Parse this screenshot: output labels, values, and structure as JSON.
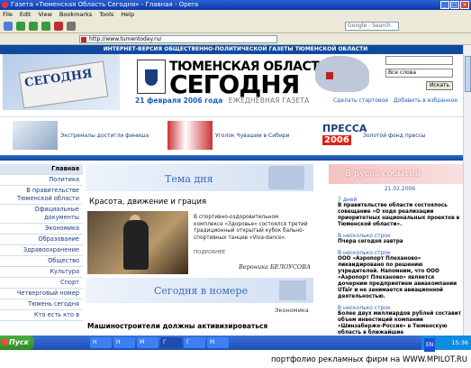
{
  "window": {
    "title": "Газета «Тюменская Область Сегодня» - Главная - Opera"
  },
  "menu": [
    "File",
    "Edit",
    "View",
    "Bookmarks",
    "Tools",
    "Help"
  ],
  "toolbar": {
    "search_placeholder": "Google - Search"
  },
  "address": {
    "url": "http://www.tumentoday.ru/"
  },
  "site": {
    "banner": "ИНТЕРНЕТ-ВЕРСИЯ ОБЩЕСТВЕННО-ПОЛИТИЧЕСКОЙ ГАЗЕТЫ ТЮМЕНСКОЙ ОБЛАСТИ",
    "logo_small": "СЕГОДНЯ",
    "logo_top": "ТЮМЕНСКАЯ ОБЛАСТЬ",
    "logo_main": "СЕГОДНЯ",
    "date": "21 февраля 2006 года",
    "subtitle": "ЕЖЕДНЕВНАЯ ГАЗЕТА",
    "search_select": "Все слова",
    "search_button": "Искать",
    "link_start": "Сделать стартовой",
    "link_fav": "Добавить в избранное"
  },
  "promos": [
    {
      "label": "Экстремалы достигли финиша"
    },
    {
      "label": "Уголок Чувашии в Сибири"
    },
    {
      "label": "Золотой фонд прессы",
      "press": "ПРЕССА",
      "year": "2006"
    }
  ],
  "nav": [
    "Главная",
    "Политика",
    "В правительстве Тюменской области",
    "Официальные документы",
    "Экономика",
    "Образование",
    "Здравоохранение",
    "Общество",
    "Культура",
    "Спорт",
    "Четверговый номер",
    "Тюмень сегодня",
    "Кто есть кто в"
  ],
  "center": {
    "tema": "Тема дня",
    "article_title": "Красота, движение и грация",
    "lead": "В спортивно-оздоровительном комплексе «Здоровье» состоялся третий традиционный открытый кубок бально-спортивных танцев «Viva-dance».",
    "more": "ПОДРОБНЕЕ",
    "author": "Вероника БЕЛОУСОВА",
    "in_number": "Сегодня в номере",
    "section": "Экономика",
    "next_title": "Машиностроители должны активизироваться"
  },
  "right": {
    "title": "В русле событий",
    "date": "21.02.2006",
    "news": [
      {
        "time": "7 дней",
        "text": "В правительстве области состоялось совещание «О ходе реализации приоритетных национальных проектов в Тюменской области»."
      },
      {
        "time": "В несколько строк",
        "text": "Пчера сегодня завтра"
      },
      {
        "time": "В несколько строк",
        "text": "ООО «Аэропорт Плеханово» ликвидировано по решению учредителей. Напомним, что ООО «Аэропорт Плеханово» является дочерним предприятием авиакомпании UTair и не занимается авиационной деятельностью."
      },
      {
        "time": "В несколько строк",
        "text": "Более двух миллиардов рублей составит объем инвестиций компании «Шинзаберже-Россия» в Тюменскую область в ближайшие"
      }
    ]
  },
  "taskbar": {
    "start": "Пуск",
    "tasks": [
      "Н",
      "Н",
      "М",
      "Г",
      "Г",
      "М"
    ],
    "lang": "EN",
    "time": "15:36"
  },
  "footer": "портфолио рекламных фирм на WWW.MPILOT.RU",
  "colors": {
    "accent": "#0f4aa0",
    "link": "#1a5dbf",
    "news_header": "#f5c3c3"
  }
}
